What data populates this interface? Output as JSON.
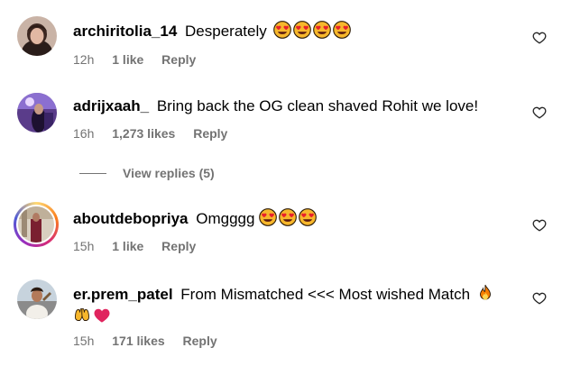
{
  "comments": [
    {
      "username": "archiritolia_14",
      "text": "Desperately",
      "emoji_count": 4,
      "emoji": "heart-eyes-emoji",
      "time": "12h",
      "likes": "1 like",
      "reply": "Reply"
    },
    {
      "username": "adrijxaah_",
      "text": "Bring back the OG clean shaved Rohit we love!",
      "time": "16h",
      "likes": "1,273 likes",
      "reply": "Reply",
      "view_replies": "View replies (5)"
    },
    {
      "username": "aboutdebopriya",
      "text": "Omgggg",
      "emoji_count": 3,
      "emoji": "heart-eyes-emoji",
      "time": "15h",
      "likes": "1 like",
      "reply": "Reply"
    },
    {
      "username": "er.prem_patel",
      "text": "From Mismatched <<< Most wished Match",
      "trailing_emojis": [
        "fire-emoji",
        "raising-hands-emoji",
        "red-heart-emoji"
      ],
      "time": "15h",
      "likes": "171 likes",
      "reply": "Reply"
    }
  ],
  "icons": {
    "like": "heart-outline-icon"
  },
  "colors": {
    "meta_text": "#737373",
    "heart_emoji": "#e0245e",
    "emoji_face": "#f7b72c"
  }
}
